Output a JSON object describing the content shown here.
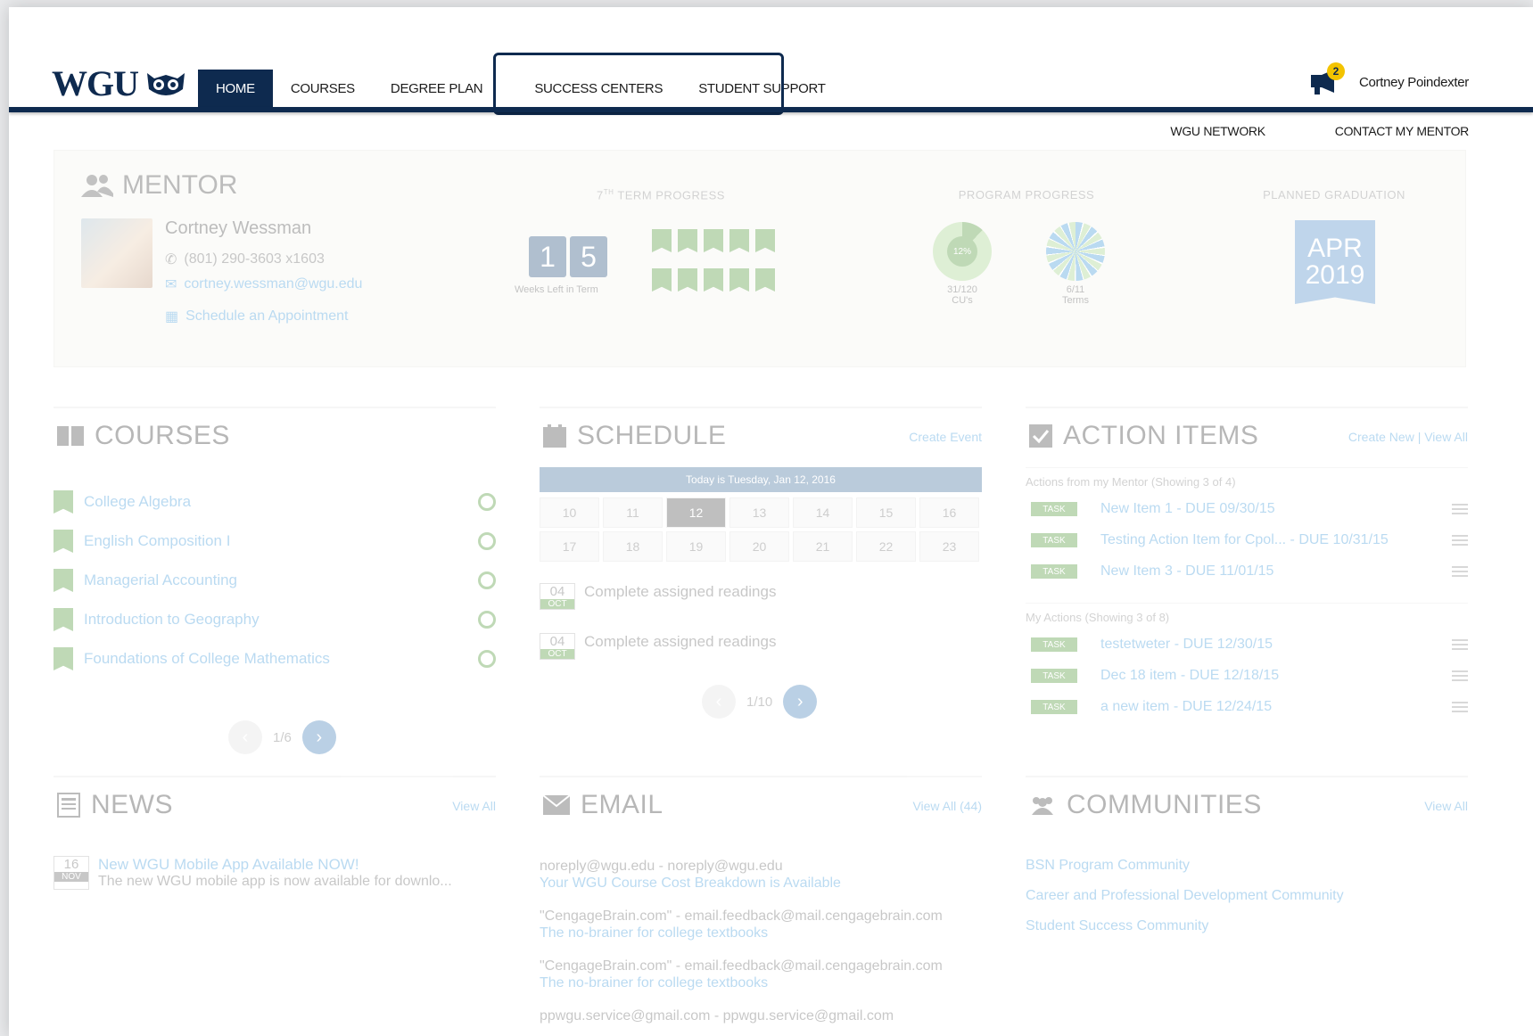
{
  "header": {
    "logo_text": "WGU",
    "nav": [
      "HOME",
      "COURSES",
      "DEGREE PLAN",
      "SUCCESS CENTERS",
      "STUDENT SUPPORT"
    ],
    "notification_count": "2",
    "user_name": "Cortney Poindexter",
    "sub_links": [
      "WGU NETWORK",
      "CONTACT MY MENTOR"
    ]
  },
  "mentor": {
    "heading": "MENTOR",
    "name": "Cortney Wessman",
    "phone": "(801) 290-3603 x1603",
    "email": "cortney.wessman@wgu.edu",
    "schedule": "Schedule an Appointment",
    "term_title_num": "7",
    "term_title_sup": "TH",
    "term_title_rest": " TERM PROGRESS",
    "weeks_digits": [
      "1",
      "5"
    ],
    "weeks_label": "Weeks Left in Term",
    "program_title": "PROGRAM PROGRESS",
    "cu_percent": "12%",
    "cu_count": "31/120",
    "cu_label": "CU's",
    "terms_count": "6/11",
    "terms_label": "Terms",
    "graduation_title": "PLANNED GRADUATION",
    "grad_month": "APR",
    "grad_year": "2019"
  },
  "courses": {
    "heading": "COURSES",
    "items": [
      "College Algebra",
      "English Composition I",
      "Managerial Accounting",
      "Introduction to Geography",
      "Foundations of College Mathematics"
    ],
    "pager": "1/6"
  },
  "schedule": {
    "heading": "SCHEDULE",
    "link": "Create Event",
    "today": "Today is Tuesday, Jan 12, 2016",
    "week1": [
      "10",
      "11",
      "12",
      "13",
      "14",
      "15",
      "16"
    ],
    "week2": [
      "17",
      "18",
      "19",
      "20",
      "21",
      "22",
      "23"
    ],
    "events": [
      {
        "day": "04",
        "month": "OCT",
        "text": "Complete assigned readings"
      },
      {
        "day": "04",
        "month": "OCT",
        "text": "Complete assigned readings"
      }
    ],
    "pager": "1/10"
  },
  "actions": {
    "heading": "ACTION ITEMS",
    "link": "Create New | View All",
    "mentor_sub": "Actions from my Mentor (Showing 3 of 4)",
    "mentor_items": [
      "New Item 1 - DUE 09/30/15",
      "Testing Action Item for Cpol...  - DUE 10/31/15",
      "New Item 3 - DUE 11/01/15"
    ],
    "my_sub": "My Actions (Showing 3 of 8)",
    "my_items": [
      "testetweter - DUE 12/30/15",
      "Dec 18 item - DUE 12/18/15",
      "a new item - DUE 12/24/15"
    ],
    "tag": "TASK"
  },
  "news": {
    "heading": "NEWS",
    "link": "View All",
    "day": "16",
    "month": "NOV",
    "title": "New WGU Mobile App Available NOW!",
    "desc": "The new WGU mobile app is now available for downlo..."
  },
  "email": {
    "heading": "EMAIL",
    "link": "View All (44)",
    "items": [
      {
        "from": "noreply@wgu.edu - noreply@wgu.edu",
        "subject": "Your WGU Course Cost Breakdown is Available"
      },
      {
        "from": "\"CengageBrain.com\" - email.feedback@mail.cengagebrain.com",
        "subject": "The no-brainer for college textbooks"
      },
      {
        "from": "\"CengageBrain.com\" - email.feedback@mail.cengagebrain.com",
        "subject": "The no-brainer for college textbooks"
      },
      {
        "from": "ppwgu.service@gmail.com - ppwgu.service@gmail.com",
        "subject": ""
      }
    ]
  },
  "communities": {
    "heading": "COMMUNITIES",
    "link": "View All",
    "items": [
      "BSN Program Community",
      "Career and Professional Development Community",
      "Student Success Community"
    ]
  }
}
